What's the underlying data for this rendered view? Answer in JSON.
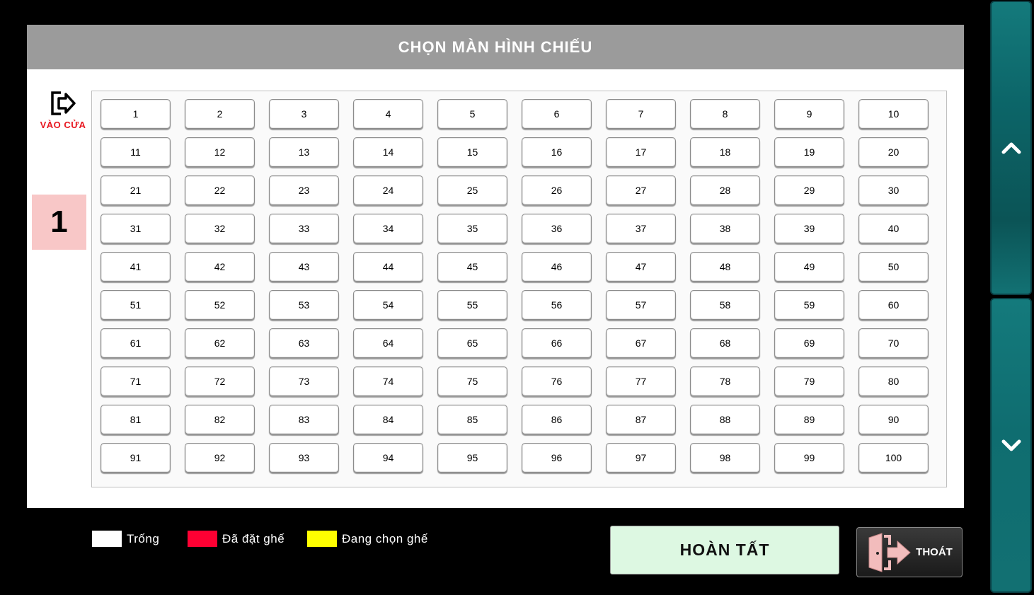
{
  "header": {
    "title": "CHỌN MÀN HÌNH CHIẾU"
  },
  "entrance": {
    "label": "VÀO CỬA",
    "icon": "door-enter-icon"
  },
  "screen": {
    "number": "1"
  },
  "seats": [
    "1",
    "2",
    "3",
    "4",
    "5",
    "6",
    "7",
    "8",
    "9",
    "10",
    "11",
    "12",
    "13",
    "14",
    "15",
    "16",
    "17",
    "18",
    "19",
    "20",
    "21",
    "22",
    "23",
    "24",
    "25",
    "26",
    "27",
    "28",
    "29",
    "30",
    "31",
    "32",
    "33",
    "34",
    "35",
    "36",
    "37",
    "38",
    "39",
    "40",
    "41",
    "42",
    "43",
    "44",
    "45",
    "46",
    "47",
    "48",
    "49",
    "50",
    "51",
    "52",
    "53",
    "54",
    "55",
    "56",
    "57",
    "58",
    "59",
    "60",
    "61",
    "62",
    "63",
    "64",
    "65",
    "66",
    "67",
    "68",
    "69",
    "70",
    "71",
    "72",
    "73",
    "74",
    "75",
    "76",
    "77",
    "78",
    "79",
    "80",
    "81",
    "82",
    "83",
    "84",
    "85",
    "86",
    "87",
    "88",
    "89",
    "90",
    "91",
    "92",
    "93",
    "94",
    "95",
    "96",
    "97",
    "98",
    "99",
    "100"
  ],
  "legend": [
    {
      "label": "Trống",
      "color": "#ffffff"
    },
    {
      "label": "Đã đặt ghế",
      "color": "#ff0033"
    },
    {
      "label": "Đang chọn ghế",
      "color": "#ffff00"
    }
  ],
  "actions": {
    "finish_label": "HOÀN TẤT",
    "exit_label": "THOÁT"
  },
  "scroll": {
    "up_icon": "chevron-up-icon",
    "down_icon": "chevron-down-icon"
  },
  "colors": {
    "accent_teal": "#0f6b6e",
    "screen_badge": "#f8c7c7",
    "finish_bg": "#ddf8e2"
  }
}
